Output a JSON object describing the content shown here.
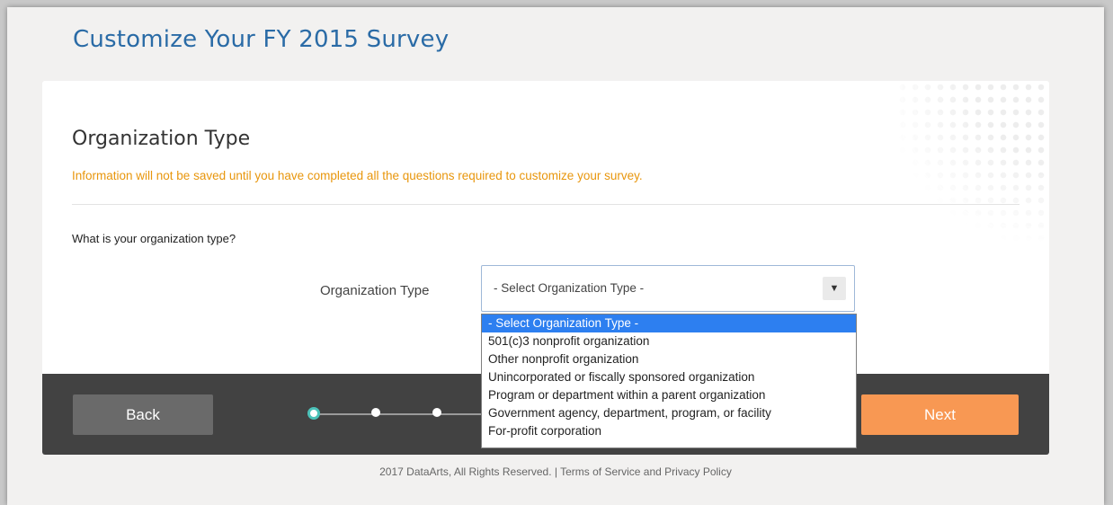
{
  "page": {
    "title": "Customize Your FY 2015 Survey"
  },
  "section": {
    "title": "Organization Type",
    "notice": "Information will not be saved until you have completed all the questions required to customize your survey.",
    "question": "What is your organization type?"
  },
  "field": {
    "label": "Organization Type",
    "value": "- Select Organization Type -",
    "arrow": "▼",
    "options": [
      "- Select Organization Type -",
      "501(c)3 nonprofit organization",
      "Other nonprofit organization",
      "Unincorporated or fiscally sponsored organization",
      "Program or department within a parent organization",
      "Government agency, department, program, or facility",
      "For-profit corporation"
    ],
    "selected_index": 0
  },
  "nav": {
    "back_label": "Back",
    "next_label": "Next",
    "current_step": 1
  },
  "footer": {
    "copyright": "2017 DataArts, All Rights Reserved.  |  Terms of Service and Privacy Policy"
  },
  "colors": {
    "title_blue": "#2a6ba6",
    "notice_orange": "#e8960c",
    "next_orange": "#f89853",
    "footer_bar": "#424242",
    "step_accent": "#4cc2b9",
    "option_highlight": "#2d7ff0"
  }
}
